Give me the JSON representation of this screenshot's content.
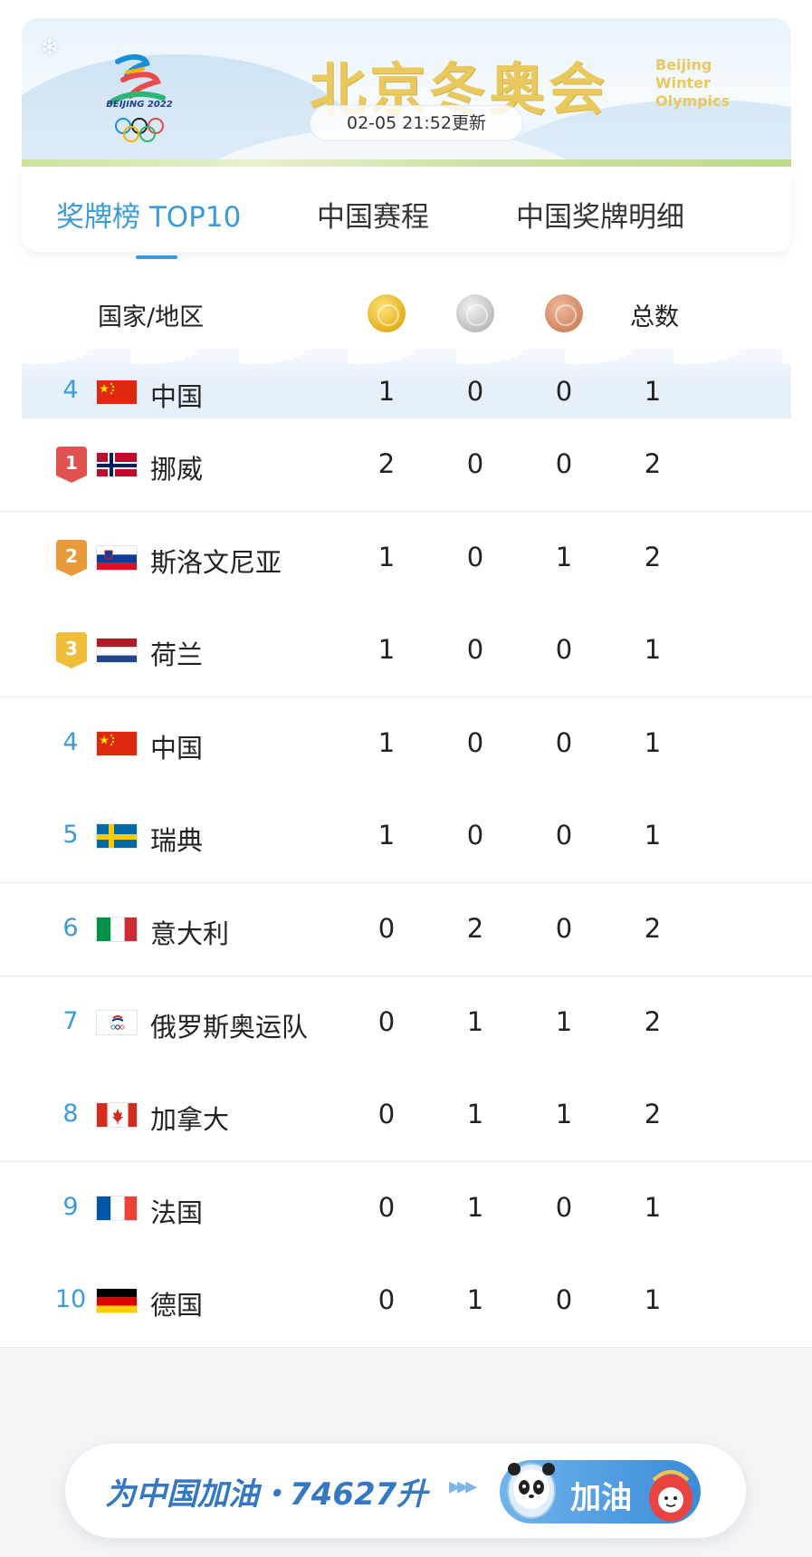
{
  "banner": {
    "title": "北京冬奥会",
    "title_en": [
      "Beijing",
      "Winter",
      "Olympics"
    ],
    "logo_text": "BEIJING 2022",
    "update_time": "02-05 21:52更新",
    "snowflake": "❄"
  },
  "tabs": [
    {
      "label": "奖牌榜 TOP10",
      "active": true
    },
    {
      "label": "中国赛程",
      "active": false
    },
    {
      "label": "中国奖牌明细",
      "active": false
    }
  ],
  "table": {
    "headers": {
      "country": "国家/地区",
      "gold_icon": "gold-medal-icon",
      "silver_icon": "silver-medal-icon",
      "bronze_icon": "bronze-medal-icon",
      "total": "总数"
    },
    "highlight": {
      "rank": "4",
      "country": "中国",
      "flag": "china",
      "gold": "1",
      "silver": "0",
      "bronze": "0",
      "total": "1"
    },
    "rows": [
      {
        "rank": "1",
        "country": "挪威",
        "flag": "norway",
        "gold": "2",
        "silver": "0",
        "bronze": "0",
        "total": "2"
      },
      {
        "rank": "2",
        "country": "斯洛文尼亚",
        "flag": "slovenia",
        "gold": "1",
        "silver": "0",
        "bronze": "1",
        "total": "2"
      },
      {
        "rank": "3",
        "country": "荷兰",
        "flag": "netherlands",
        "gold": "1",
        "silver": "0",
        "bronze": "0",
        "total": "1"
      },
      {
        "rank": "4",
        "country": "中国",
        "flag": "china",
        "gold": "1",
        "silver": "0",
        "bronze": "0",
        "total": "1"
      },
      {
        "rank": "5",
        "country": "瑞典",
        "flag": "sweden",
        "gold": "1",
        "silver": "0",
        "bronze": "0",
        "total": "1"
      },
      {
        "rank": "6",
        "country": "意大利",
        "flag": "italy",
        "gold": "0",
        "silver": "2",
        "bronze": "0",
        "total": "2"
      },
      {
        "rank": "7",
        "country": "俄罗斯奥运队",
        "flag": "roc",
        "gold": "0",
        "silver": "1",
        "bronze": "1",
        "total": "2"
      },
      {
        "rank": "8",
        "country": "加拿大",
        "flag": "canada",
        "gold": "0",
        "silver": "1",
        "bronze": "1",
        "total": "2"
      },
      {
        "rank": "9",
        "country": "法国",
        "flag": "france",
        "gold": "0",
        "silver": "1",
        "bronze": "0",
        "total": "1"
      },
      {
        "rank": "10",
        "country": "德国",
        "flag": "germany",
        "gold": "0",
        "silver": "1",
        "bronze": "0",
        "total": "1"
      }
    ]
  },
  "cheer": {
    "text": "为中国加油・74627升",
    "arrows": "▸▸▸",
    "button_label": "加油"
  },
  "colors": {
    "accent": "#3c9bd6",
    "gold_title": "#e9c85e",
    "cheer_blue": "#3478c4",
    "rank1": "#e0514f",
    "rank2": "#eb9a3a",
    "rank3": "#f0bd3b"
  }
}
